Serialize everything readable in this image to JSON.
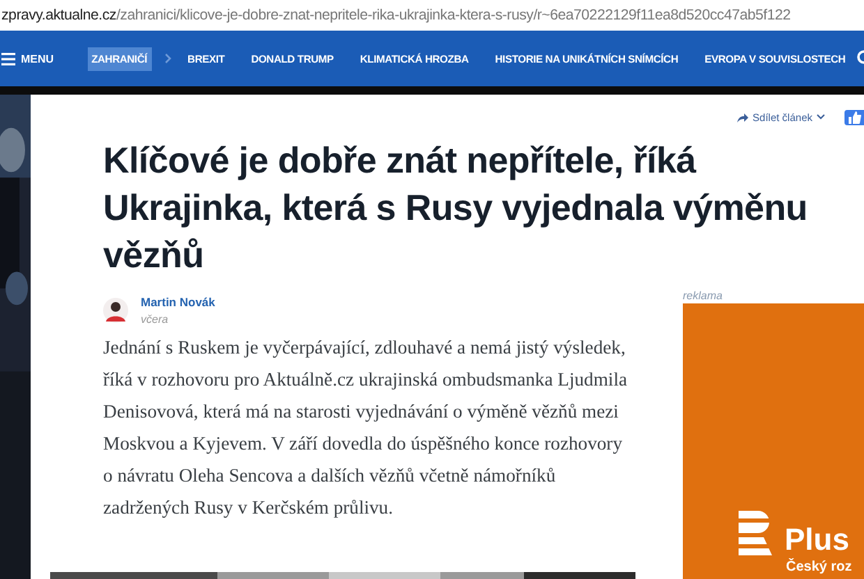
{
  "address_bar": {
    "domain": "zpravy.aktualne.cz",
    "path": "/zahranici/klicove-je-dobre-znat-nepritele-rika-ukrajinka-ktera-s-rusy/r~6ea70222129f11ea8d520cc47ab5f122"
  },
  "nav": {
    "menu_label": "MENU",
    "items": [
      {
        "label": "ZAHRANIČÍ",
        "selected": true
      },
      {
        "label": "BREXIT",
        "selected": false
      },
      {
        "label": "DONALD TRUMP",
        "selected": false
      },
      {
        "label": "KLIMATICKÁ HROZBA",
        "selected": false
      },
      {
        "label": "HISTORIE NA UNIKÁTNÍCH SNÍMCÍCH",
        "selected": false
      },
      {
        "label": "EVROPA V SOUVISLOSTECH",
        "selected": false
      }
    ]
  },
  "article": {
    "share_label": "Sdílet článek",
    "title": "Klíčové je dobře znát nepřítele, říká Ukrajinka, která s Rusy vyjednala výměnu vězňů",
    "author": "Martin Novák",
    "date": "včera",
    "perex": "Jednání s Ruskem je vyčerpávající, zdlouhavé a nemá jistý výsledek, říká v rozhovoru pro Aktuálně.cz ukrajinská ombudsmanka Ljudmila Denisovová, která má na starosti vyjednávání o výměně vězňů mezi Moskvou a Kyjevem. V září dovedla do úspěšného konce rozhovory o návratu Oleha Sencova a dalších vězňů včetně námořníků zadržených Rusy v Kerčském průlivu."
  },
  "ad": {
    "label": "reklama",
    "brand": "Plus",
    "tagline": "Český roz"
  }
}
